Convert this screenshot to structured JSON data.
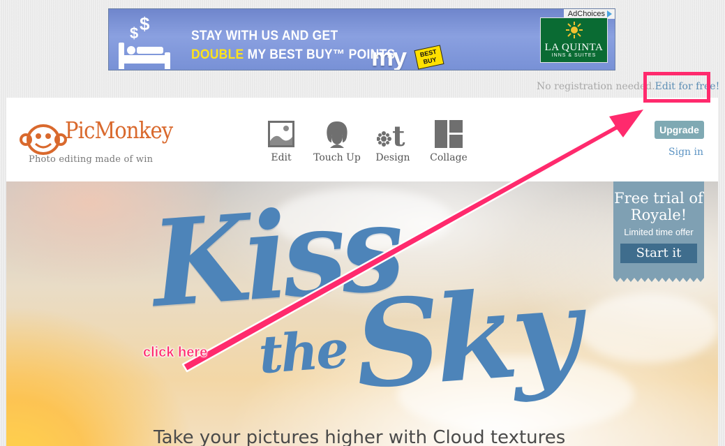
{
  "ad": {
    "ad_choices_label": "AdChoices",
    "line1": "STAY WITH US AND GET",
    "line2_highlight": "DOUBLE",
    "line2_rest": " MY BEST BUY™ POINTS",
    "my_label": "my",
    "best_buy_label": "BEST BUY",
    "hotel_brand": "LA QUINTA",
    "hotel_sub": "INNS & SUITES",
    "colors": {
      "background": "#7891d6",
      "highlight": "#ffe31a",
      "hotel_green": "#0a6b33"
    }
  },
  "registration": {
    "text": "No registration needed.",
    "link": "Edit for free!"
  },
  "header": {
    "brand": "PicMonkey",
    "tagline": "Photo editing made of win",
    "nav": [
      {
        "label": "Edit",
        "icon": "image-icon"
      },
      {
        "label": "Touch Up",
        "icon": "face-icon"
      },
      {
        "label": "Design",
        "icon": "design-icon"
      },
      {
        "label": "Collage",
        "icon": "collage-icon"
      }
    ],
    "upgrade_label": "Upgrade",
    "signin_label": "Sign in",
    "colors": {
      "brand_orange": "#d9692d",
      "upgrade_bg": "#7fa9b3",
      "link_blue": "#5b93c3"
    }
  },
  "hero": {
    "title_line1": "Kiss",
    "title_line2": "the",
    "title_line3": "Sky",
    "subhead": "Take your pictures higher with Cloud textures",
    "royale": {
      "title": "Free trial of Royale!",
      "subtitle": "Limited time offer",
      "button": "Start it"
    },
    "colors": {
      "title_blue": "#4d84b9",
      "royale_bg": "#7fa0b3",
      "royale_button": "#3f6d8d"
    }
  },
  "annotation": {
    "label": "click here",
    "color": "#ff2a6d"
  }
}
